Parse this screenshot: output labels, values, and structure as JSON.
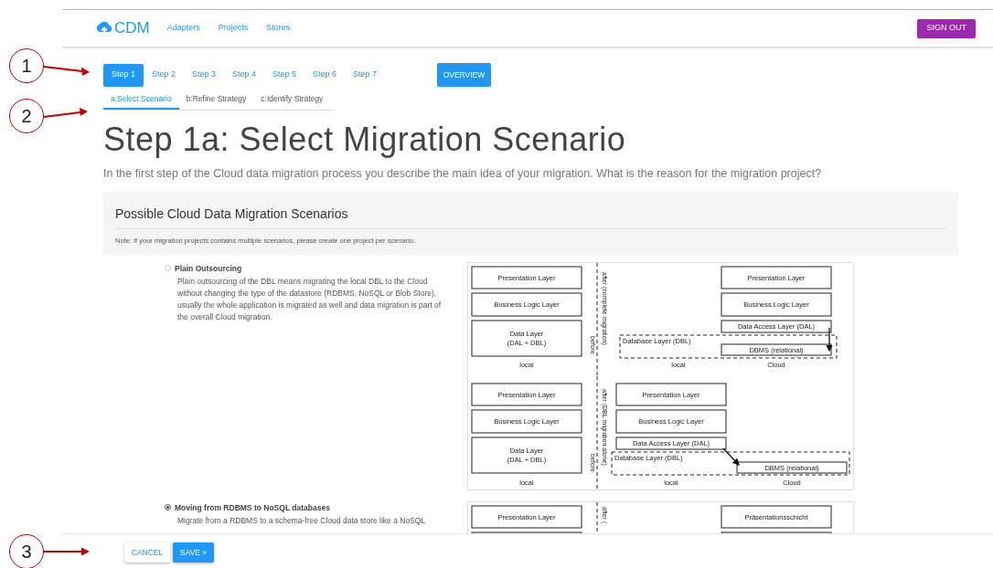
{
  "nav": {
    "logo": "CDM",
    "links": [
      "Adapters",
      "Projects",
      "Stores"
    ],
    "sign_out": "SIGN OUT"
  },
  "steps": [
    {
      "label": "Step 1",
      "selected": true
    },
    {
      "label": "Step 2",
      "selected": false
    },
    {
      "label": "Step 3",
      "selected": false
    },
    {
      "label": "Step 4",
      "selected": false
    },
    {
      "label": "Step 5",
      "selected": false
    },
    {
      "label": "Step 6",
      "selected": false
    },
    {
      "label": "Step 7",
      "selected": false
    }
  ],
  "overview": "OVERVIEW",
  "subtabs": [
    {
      "label": "a:Select Scenario",
      "selected": true
    },
    {
      "label": "b:Refine Strategy",
      "selected": false
    },
    {
      "label": "c:Identify Strategy",
      "selected": false
    }
  ],
  "heading": "Step 1a: Select Migration Scenario",
  "intro": "In the first step of the Cloud data migration process you describe the main idea of your migration. What is the reason for the migration project?",
  "panel": {
    "title": "Possible Cloud Data Migration Scenarios",
    "note": "Note: If your migration projects contains multiple scenarios, please create one project per scenario."
  },
  "scenarios": [
    {
      "title": "Plain Outsourcing",
      "selected": false,
      "description": "Plain outsourcing of the DBL means migrating the local DBL to the Cloud without changing the type of the datastore (RDBMS, NoSQL or Blob Store), usually the whole application is migrated as well and data migration is part of the overall Cloud migration.",
      "diagrams": [
        {
          "kind": "complete",
          "before_boxes": [
            [
              "Presentation Layer"
            ],
            [
              "Business Logic Layer"
            ],
            [
              "Data Layer",
              "(DAL + DBL)"
            ]
          ],
          "before_label": "local",
          "divider_before": "before",
          "divider_after": "after (complete migration)",
          "after_boxes": [
            [
              "Presentation Layer"
            ],
            [
              "Business Logic Layer"
            ],
            [
              "Data Access Layer (DAL)"
            ],
            [
              "DBMS (relational)"
            ]
          ],
          "dbl_label": "Database Layer (DBL)",
          "local_label": "local",
          "cloud_label": "Cloud"
        },
        {
          "kind": "dbl_only",
          "before_boxes": [
            [
              "Presentation Layer"
            ],
            [
              "Business Logic Layer"
            ],
            [
              "Data Layer",
              "(DAL + DBL)"
            ]
          ],
          "before_label": "local",
          "divider_before": "before",
          "divider_after": "after (DBL migration alone)",
          "after_boxes": [
            [
              "Presentation Layer"
            ],
            [
              "Business Logic Layer"
            ],
            [
              "Data Access Layer (DAL)"
            ],
            [
              "DBMS (relational)"
            ]
          ],
          "dbl_label": "Database Layer (DBL)",
          "local_label": "local",
          "cloud_label": "Cloud"
        }
      ]
    },
    {
      "title": "Moving from RDBMS to NoSQL databases",
      "selected": true,
      "description": "Migrate from a RDBMS to a schema-free Cloud data store like a NoSQL",
      "diagrams": [
        {
          "kind": "cut",
          "before_boxes": [
            [
              "Presentation Layer"
            ]
          ],
          "divider_after": "after (",
          "after_boxes": [
            [
              "Präsentationsschicht"
            ]
          ]
        }
      ]
    }
  ],
  "footer": {
    "cancel": "CANCEL",
    "save": "SAVE »"
  },
  "callouts": [
    "1",
    "2",
    "3"
  ]
}
